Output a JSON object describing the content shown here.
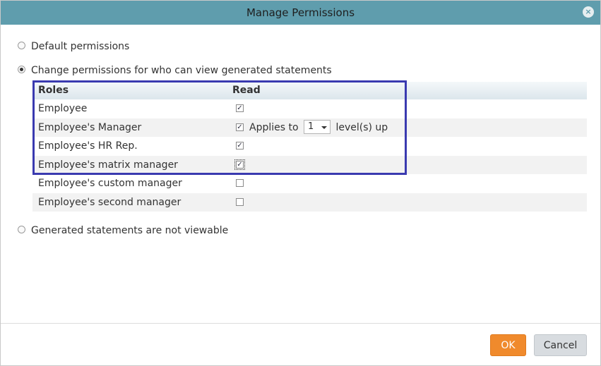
{
  "dialog": {
    "title": "Manage Permissions",
    "close_symbol": "×"
  },
  "options": {
    "default": "Default permissions",
    "change": "Change permissions for who can view generated statements",
    "not_viewable": "Generated statements are not viewable",
    "selected": "change"
  },
  "table": {
    "headers": {
      "roles": "Roles",
      "read": "Read"
    },
    "rows": [
      {
        "role": "Employee",
        "read": true
      },
      {
        "role": "Employee's Manager",
        "read": true
      },
      {
        "role": "Employee's HR Rep.",
        "read": true
      },
      {
        "role": "Employee's matrix manager",
        "read": true
      },
      {
        "role": "Employee's custom manager",
        "read": false
      },
      {
        "role": "Employee's second manager",
        "read": false
      }
    ],
    "applies": {
      "prefix": "Applies to",
      "level": "1",
      "suffix": "level(s) up"
    }
  },
  "buttons": {
    "ok": "OK",
    "cancel": "Cancel"
  },
  "colors": {
    "titlebar": "#5f9dad",
    "ok": "#f08a2c",
    "highlight": "#3a3ab0"
  }
}
